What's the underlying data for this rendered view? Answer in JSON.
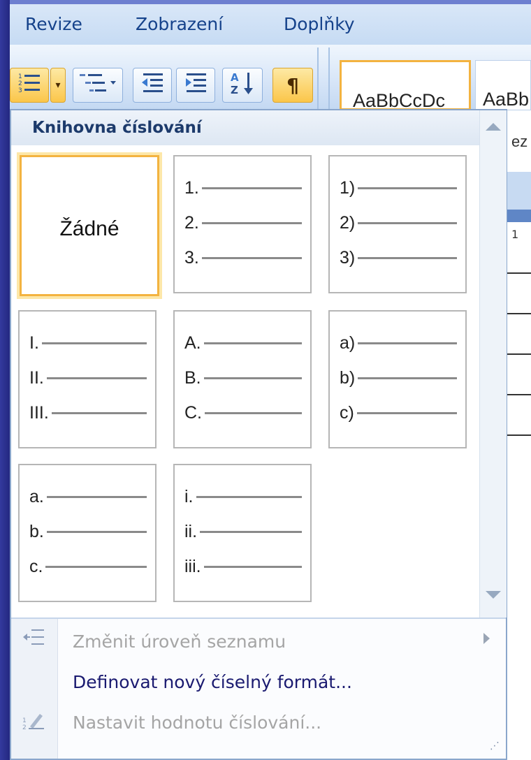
{
  "ribbon_tabs": [
    "Revize",
    "Zobrazení",
    "Doplňky"
  ],
  "ribbon_buttons": {
    "numbering": "numbering-icon",
    "dropdown": "▾",
    "multilevel": "multilevel-list-icon",
    "decrease_indent": "decrease-indent-icon",
    "increase_indent": "increase-indent-icon",
    "sort": "sort-icon",
    "show_marks": "¶"
  },
  "styles_gallery": [
    "AaBbCcDc",
    "AaBb"
  ],
  "styles_partial_label": "ez",
  "doc_ruler_text": "1",
  "panel": {
    "title": "Knihovna číslování",
    "none_label": "Žádné",
    "formats": [
      {
        "items": [
          "1.",
          "2.",
          "3."
        ]
      },
      {
        "items": [
          "1)",
          "2)",
          "3)"
        ]
      },
      {
        "items": [
          "I.",
          "II.",
          "III."
        ]
      },
      {
        "items": [
          "A.",
          "B.",
          "C."
        ]
      },
      {
        "items": [
          "a)",
          "b)",
          "c)"
        ]
      },
      {
        "items": [
          "a.",
          "b.",
          "c."
        ]
      },
      {
        "items": [
          "i.",
          "ii.",
          "iii."
        ]
      }
    ]
  },
  "menu": {
    "change_level": "Změnit úroveň seznamu",
    "define_format": "Definovat nový číselný formát...",
    "set_value": "Nastavit hodnotu číslování..."
  },
  "colors": {
    "selection": "#f3b340",
    "title": "#1c3a6b",
    "tab_text": "#15428b"
  }
}
